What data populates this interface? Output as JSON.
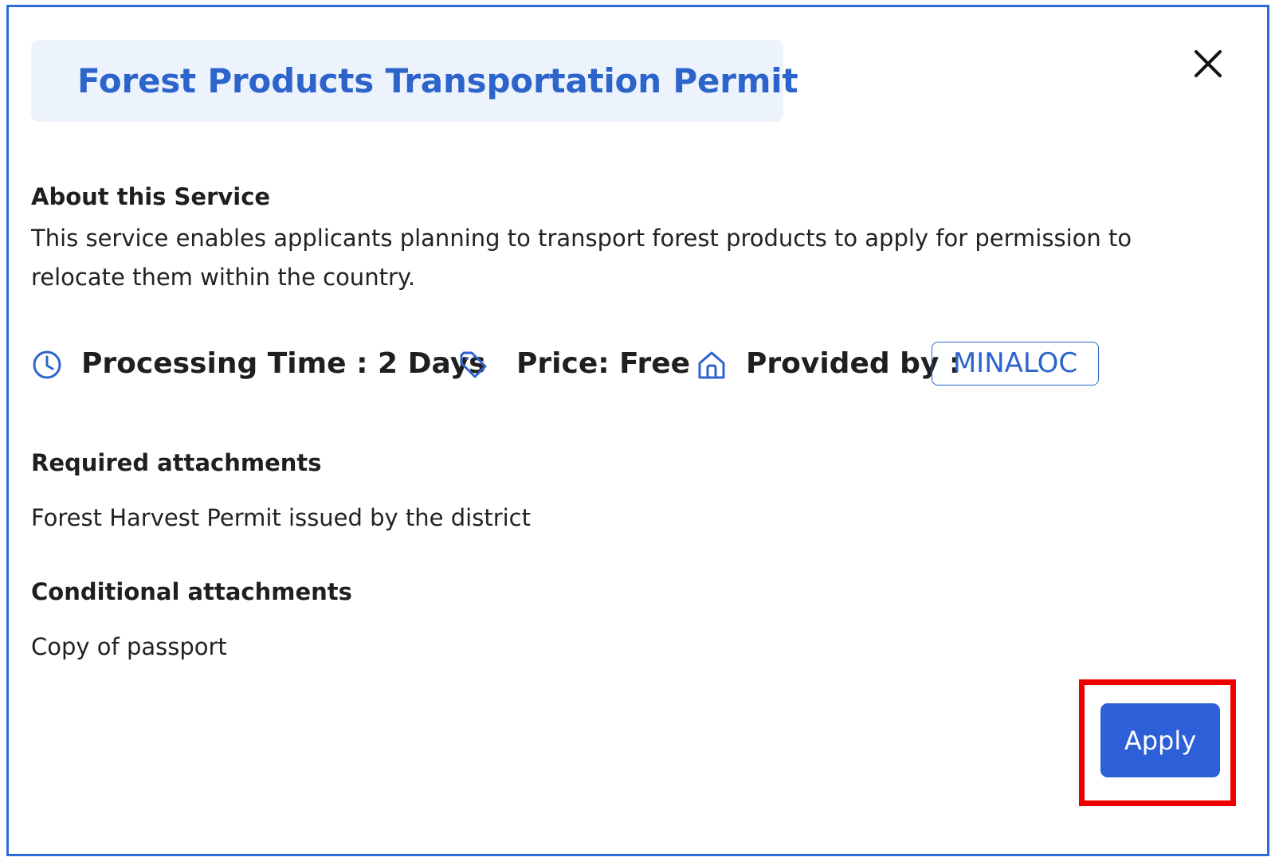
{
  "modal": {
    "title": "Forest Products Transportation Permit",
    "close_icon": "close-icon"
  },
  "about": {
    "heading": "About this Service",
    "text": "This service enables applicants planning to transport forest products to apply for permission to relocate them within the country."
  },
  "meta": {
    "processing_icon": "clock-icon",
    "processing_label": "Processing Time : 2 Days",
    "price_icon": "tag-icon",
    "price_label": "Price: Free",
    "provider_icon": "home-icon",
    "provider_label": "Provided by :",
    "provider_name": "MINALOC"
  },
  "required": {
    "heading": "Required attachments",
    "text": "Forest Harvest Permit issued by the district"
  },
  "conditional": {
    "heading": "Conditional attachments",
    "text": "Copy of passport"
  },
  "actions": {
    "apply_label": "Apply"
  },
  "colors": {
    "accent": "#2d64cc",
    "title_bg": "#edf3fc",
    "button_bg": "#2d5fd9",
    "highlight": "#ee0000",
    "modal_border": "#2d6ad6"
  }
}
